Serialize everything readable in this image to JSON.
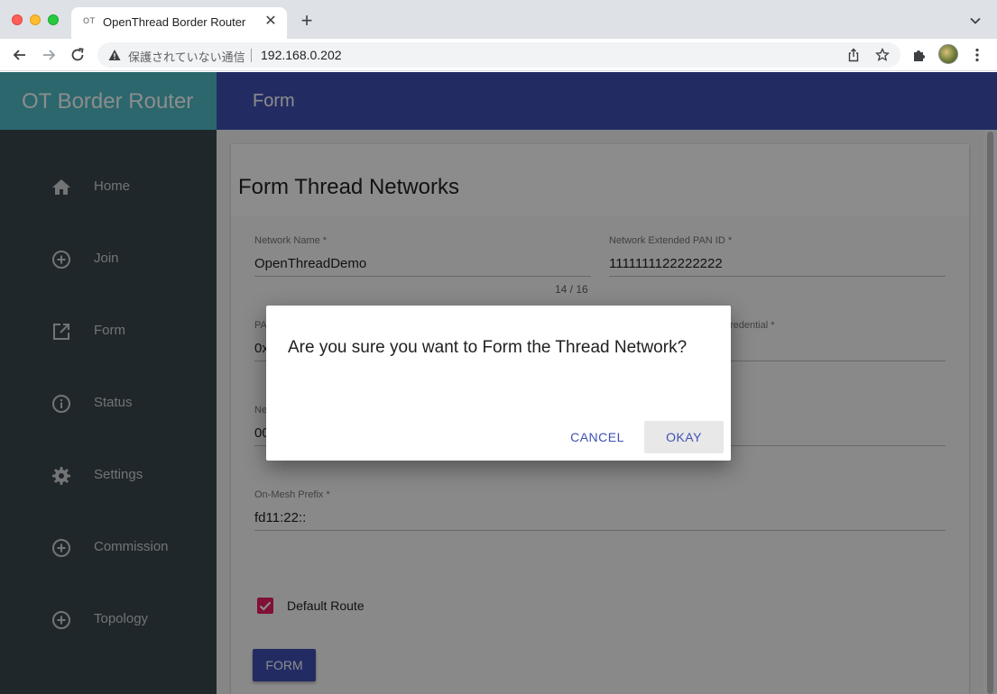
{
  "browser": {
    "tab_title": "OpenThread Border Router",
    "tab_favicon": "OT",
    "security_text": "保護されていない通信",
    "url": "192.168.0.202"
  },
  "app": {
    "brand": "OT Border Router",
    "page_title": "Form",
    "colors": {
      "brand_bg": "#4fbcc7",
      "appbar_bg": "#3f51b5",
      "sidebar_bg": "#3b474d",
      "accent": "#e91e63"
    }
  },
  "sidebar": {
    "items": [
      {
        "label": "Home",
        "icon": "home-icon"
      },
      {
        "label": "Join",
        "icon": "add-circle-icon"
      },
      {
        "label": "Form",
        "icon": "open-in-new-icon"
      },
      {
        "label": "Status",
        "icon": "info-icon"
      },
      {
        "label": "Settings",
        "icon": "gear-icon"
      },
      {
        "label": "Commission",
        "icon": "add-circle-icon"
      },
      {
        "label": "Topology",
        "icon": "add-circle-icon"
      }
    ]
  },
  "form": {
    "title": "Form Thread Networks",
    "network_name": {
      "label": "Network Name *",
      "value": "OpenThreadDemo",
      "counter": "14 / 16"
    },
    "ext_pan_id": {
      "label": "Network Extended PAN ID *",
      "value": "1111111122222222"
    },
    "pan_id": {
      "label": "PA",
      "value": "0x"
    },
    "credential": {
      "label": "Credential *"
    },
    "network_key": {
      "label": "Ne",
      "value": "00"
    },
    "on_mesh_prefix": {
      "label": "On-Mesh Prefix *",
      "value": "fd11:22::"
    },
    "default_route": {
      "label": "Default Route",
      "checked": true
    },
    "submit_label": "FORM"
  },
  "dialog": {
    "message": "Are you sure you want to Form the Thread Network?",
    "cancel_label": "CANCEL",
    "okay_label": "OKAY"
  }
}
